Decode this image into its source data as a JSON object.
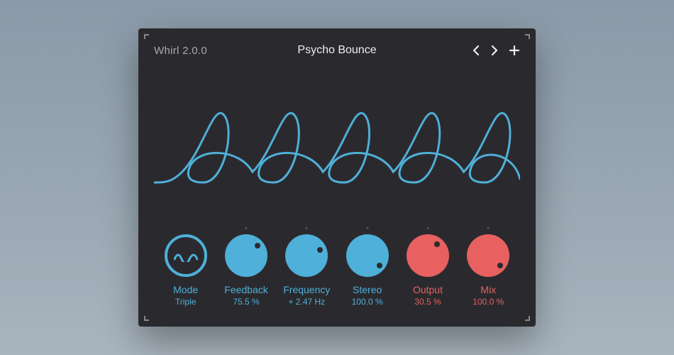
{
  "app": "Whirl 2.0.0",
  "preset": "Psycho Bounce",
  "colors": {
    "blue": "#4fb0d9",
    "red": "#e86060",
    "bg": "#2a2a2e"
  },
  "knobs": {
    "mode": {
      "label": "Mode",
      "value": "Triple",
      "color": "blue",
      "type": "mode"
    },
    "feedback": {
      "label": "Feedback",
      "value": "75.5 %",
      "color": "blue",
      "angle": 55
    },
    "frequency": {
      "label": "Frequency",
      "value": "+ 2.47 Hz",
      "color": "blue",
      "angle": 70
    },
    "stereo": {
      "label": "Stereo",
      "value": "100.0 %",
      "color": "blue",
      "angle": 125
    },
    "output": {
      "label": "Output",
      "value": "30.5 %",
      "color": "red",
      "angle": 40
    },
    "mix": {
      "label": "Mix",
      "value": "100.0 %",
      "color": "red",
      "angle": 125
    }
  }
}
